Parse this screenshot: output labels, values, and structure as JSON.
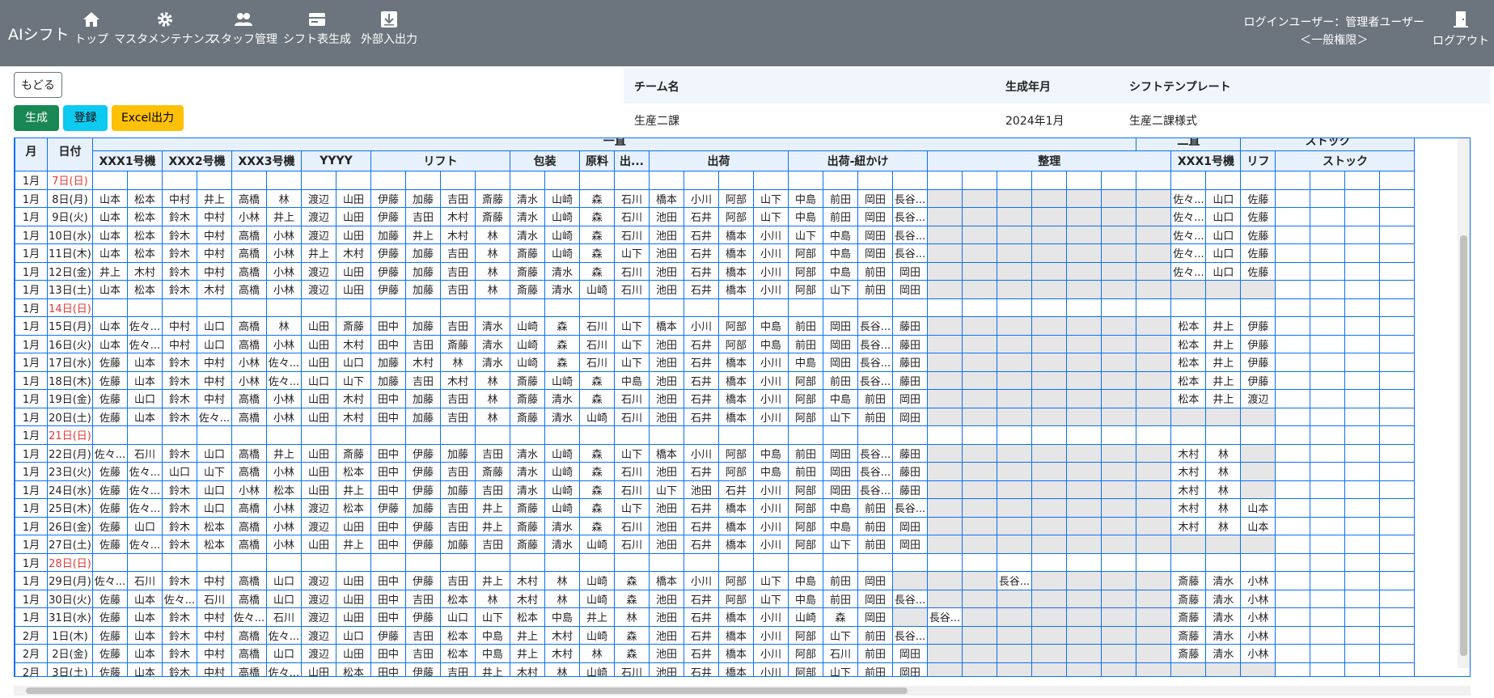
{
  "app": {
    "brand": "AIシフト"
  },
  "nav": [
    {
      "label": "トップ",
      "icon": "home-icon"
    },
    {
      "label": "マスタメンテナンス",
      "icon": "gear-icon"
    },
    {
      "label": "スタッフ管理",
      "icon": "users-icon"
    },
    {
      "label": "シフト表生成",
      "icon": "card-icon"
    },
    {
      "label": "外部入出力",
      "icon": "download-icon"
    }
  ],
  "user": {
    "line1": "ログインユーザー：管理者ユーザー",
    "line2": "＜一般権限＞",
    "logout": "ログアウト"
  },
  "buttons": {
    "back": "もどる",
    "generate": "生成",
    "register": "登録",
    "excel": "Excel出力"
  },
  "colors": {
    "nav": "#6c757d",
    "generate": "#198754",
    "register": "#0dcaf0",
    "excel": "#ffc107",
    "grid": "#0d6efd",
    "holiday": "#e53935"
  },
  "info": {
    "team_label": "チーム名",
    "month_label": "生成年月",
    "template_label": "シフトテンプレート",
    "team": "生産二課",
    "month": "2024年1月",
    "template": "生産二課様式"
  },
  "table": {
    "groups": [
      {
        "label": "一直",
        "span": 30
      },
      {
        "label": "二直",
        "span": 3
      },
      {
        "label": "ストック",
        "span": 5
      }
    ],
    "h_month": "月",
    "h_date": "日付",
    "headers": [
      {
        "label": "XXX1号機",
        "span": 2
      },
      {
        "label": "XXX2号機",
        "span": 2
      },
      {
        "label": "XXX3号機",
        "span": 2
      },
      {
        "label": "YYYY",
        "span": 2
      },
      {
        "label": "リフト",
        "span": 4
      },
      {
        "label": "包装",
        "span": 2
      },
      {
        "label": "原料",
        "span": 1
      },
      {
        "label": "出...",
        "span": 1
      },
      {
        "label": "出荷",
        "span": 4
      },
      {
        "label": "出荷-紐かけ",
        "span": 4
      },
      {
        "label": "整理",
        "span": 7
      },
      {
        "label": "XXX1号機",
        "span": 2
      },
      {
        "label": "リフ",
        "span": 1
      },
      {
        "label": "ストック",
        "span": 5
      }
    ],
    "rows": [
      {
        "m": "1月",
        "d": "7日(日)",
        "h": true,
        "c": []
      },
      {
        "m": "1月",
        "d": "8日(月)",
        "c": [
          "山本",
          "松本",
          "中村",
          "井上",
          "高橋",
          "林",
          "渡辺",
          "山田",
          "伊藤",
          "加藤",
          "吉田",
          "斎藤",
          "清水",
          "山崎",
          "森",
          "石川",
          "橋本",
          "小川",
          "阿部",
          "山下",
          "中島",
          "前田",
          "岡田",
          "長谷...",
          "",
          "",
          "",
          "",
          "",
          "",
          "",
          "佐々...",
          "山口",
          "佐藤"
        ]
      },
      {
        "m": "1月",
        "d": "9日(火)",
        "c": [
          "山本",
          "松本",
          "鈴木",
          "中村",
          "小林",
          "井上",
          "渡辺",
          "山田",
          "伊藤",
          "吉田",
          "木村",
          "斎藤",
          "清水",
          "山崎",
          "森",
          "石川",
          "池田",
          "石井",
          "阿部",
          "山下",
          "中島",
          "前田",
          "岡田",
          "長谷...",
          "",
          "",
          "",
          "",
          "",
          "",
          "",
          "佐々...",
          "山口",
          "佐藤"
        ]
      },
      {
        "m": "1月",
        "d": "10日(水)",
        "c": [
          "山本",
          "松本",
          "鈴木",
          "中村",
          "高橋",
          "小林",
          "渡辺",
          "山田",
          "加藤",
          "井上",
          "木村",
          "林",
          "清水",
          "山崎",
          "森",
          "石川",
          "池田",
          "石井",
          "橋本",
          "小川",
          "山下",
          "中島",
          "岡田",
          "長谷...",
          "",
          "",
          "",
          "",
          "",
          "",
          "",
          "佐々...",
          "山口",
          "佐藤"
        ]
      },
      {
        "m": "1月",
        "d": "11日(木)",
        "c": [
          "山本",
          "松本",
          "鈴木",
          "中村",
          "高橋",
          "小林",
          "井上",
          "木村",
          "伊藤",
          "加藤",
          "吉田",
          "林",
          "斎藤",
          "山崎",
          "森",
          "山下",
          "池田",
          "石井",
          "橋本",
          "小川",
          "阿部",
          "中島",
          "岡田",
          "長谷...",
          "",
          "",
          "",
          "",
          "",
          "",
          "",
          "佐々...",
          "山口",
          "佐藤"
        ]
      },
      {
        "m": "1月",
        "d": "12日(金)",
        "c": [
          "井上",
          "木村",
          "鈴木",
          "中村",
          "高橋",
          "小林",
          "渡辺",
          "山田",
          "伊藤",
          "加藤",
          "吉田",
          "林",
          "斎藤",
          "清水",
          "森",
          "石川",
          "池田",
          "石井",
          "橋本",
          "小川",
          "阿部",
          "中島",
          "前田",
          "岡田",
          "",
          "",
          "",
          "",
          "",
          "",
          "",
          "佐々...",
          "山口",
          "佐藤"
        ]
      },
      {
        "m": "1月",
        "d": "13日(土)",
        "c": [
          "山本",
          "松本",
          "鈴木",
          "木村",
          "高橋",
          "小林",
          "渡辺",
          "山田",
          "伊藤",
          "加藤",
          "吉田",
          "林",
          "斎藤",
          "清水",
          "山崎",
          "石川",
          "池田",
          "石井",
          "橋本",
          "小川",
          "阿部",
          "山下",
          "前田",
          "岡田",
          "",
          "",
          "",
          "",
          "",
          "",
          "",
          "",
          "",
          ""
        ]
      },
      {
        "m": "1月",
        "d": "14日(日)",
        "h": true,
        "c": []
      },
      {
        "m": "1月",
        "d": "15日(月)",
        "c": [
          "山本",
          "佐々...",
          "中村",
          "山口",
          "高橋",
          "林",
          "山田",
          "斎藤",
          "田中",
          "加藤",
          "吉田",
          "清水",
          "山崎",
          "森",
          "石川",
          "山下",
          "橋本",
          "小川",
          "阿部",
          "中島",
          "前田",
          "岡田",
          "長谷...",
          "藤田",
          "",
          "",
          "",
          "",
          "",
          "",
          "",
          "松本",
          "井上",
          "伊藤"
        ]
      },
      {
        "m": "1月",
        "d": "16日(火)",
        "c": [
          "山本",
          "佐々...",
          "中村",
          "山口",
          "高橋",
          "小林",
          "山田",
          "木村",
          "田中",
          "吉田",
          "斎藤",
          "清水",
          "山崎",
          "森",
          "石川",
          "山下",
          "池田",
          "石井",
          "阿部",
          "中島",
          "前田",
          "岡田",
          "長谷...",
          "藤田",
          "",
          "",
          "",
          "",
          "",
          "",
          "",
          "松本",
          "井上",
          "伊藤"
        ]
      },
      {
        "m": "1月",
        "d": "17日(水)",
        "c": [
          "佐藤",
          "山本",
          "鈴木",
          "中村",
          "小林",
          "佐々...",
          "山田",
          "山口",
          "加藤",
          "木村",
          "林",
          "清水",
          "山崎",
          "森",
          "石川",
          "山下",
          "池田",
          "石井",
          "橋本",
          "小川",
          "中島",
          "岡田",
          "長谷...",
          "藤田",
          "",
          "",
          "",
          "",
          "",
          "",
          "",
          "松本",
          "井上",
          "伊藤"
        ]
      },
      {
        "m": "1月",
        "d": "18日(木)",
        "c": [
          "佐藤",
          "山本",
          "鈴木",
          "中村",
          "小林",
          "佐々...",
          "山口",
          "山下",
          "加藤",
          "吉田",
          "木村",
          "林",
          "斎藤",
          "山崎",
          "森",
          "中島",
          "池田",
          "石井",
          "橋本",
          "小川",
          "阿部",
          "前田",
          "長谷...",
          "藤田",
          "",
          "",
          "",
          "",
          "",
          "",
          "",
          "松本",
          "井上",
          "伊藤"
        ]
      },
      {
        "m": "1月",
        "d": "19日(金)",
        "c": [
          "佐藤",
          "山口",
          "鈴木",
          "中村",
          "高橋",
          "小林",
          "山田",
          "木村",
          "田中",
          "加藤",
          "吉田",
          "林",
          "斎藤",
          "清水",
          "森",
          "石川",
          "池田",
          "石井",
          "橋本",
          "小川",
          "阿部",
          "中島",
          "前田",
          "岡田",
          "",
          "",
          "",
          "",
          "",
          "",
          "",
          "松本",
          "井上",
          "渡辺"
        ]
      },
      {
        "m": "1月",
        "d": "20日(土)",
        "c": [
          "佐藤",
          "山本",
          "鈴木",
          "佐々...",
          "高橋",
          "小林",
          "山田",
          "木村",
          "田中",
          "加藤",
          "吉田",
          "林",
          "斎藤",
          "清水",
          "山崎",
          "石川",
          "池田",
          "石井",
          "橋本",
          "小川",
          "阿部",
          "山下",
          "前田",
          "岡田",
          "",
          "",
          "",
          "",
          "",
          "",
          "",
          "",
          "",
          ""
        ]
      },
      {
        "m": "1月",
        "d": "21日(日)",
        "h": true,
        "c": []
      },
      {
        "m": "1月",
        "d": "22日(月)",
        "c": [
          "佐々...",
          "石川",
          "鈴木",
          "山口",
          "高橋",
          "井上",
          "山田",
          "斎藤",
          "田中",
          "伊藤",
          "加藤",
          "吉田",
          "清水",
          "山崎",
          "森",
          "山下",
          "橋本",
          "小川",
          "阿部",
          "中島",
          "前田",
          "岡田",
          "長谷...",
          "藤田",
          "",
          "",
          "",
          "",
          "",
          "",
          "",
          "木村",
          "林",
          ""
        ]
      },
      {
        "m": "1月",
        "d": "23日(火)",
        "c": [
          "佐藤",
          "佐々...",
          "山口",
          "山下",
          "高橋",
          "小林",
          "山田",
          "松本",
          "田中",
          "伊藤",
          "吉田",
          "斎藤",
          "清水",
          "山崎",
          "森",
          "石川",
          "池田",
          "石井",
          "阿部",
          "中島",
          "前田",
          "岡田",
          "長谷...",
          "藤田",
          "",
          "",
          "",
          "",
          "",
          "",
          "",
          "木村",
          "林",
          ""
        ]
      },
      {
        "m": "1月",
        "d": "24日(水)",
        "c": [
          "佐藤",
          "佐々...",
          "鈴木",
          "山口",
          "小林",
          "松本",
          "山田",
          "井上",
          "田中",
          "伊藤",
          "加藤",
          "吉田",
          "清水",
          "山崎",
          "森",
          "石川",
          "山下",
          "池田",
          "石井",
          "小川",
          "阿部",
          "岡田",
          "長谷...",
          "藤田",
          "",
          "",
          "",
          "",
          "",
          "",
          "",
          "木村",
          "林",
          ""
        ]
      },
      {
        "m": "1月",
        "d": "25日(木)",
        "c": [
          "佐藤",
          "佐々...",
          "鈴木",
          "山口",
          "高橋",
          "小林",
          "渡辺",
          "松本",
          "伊藤",
          "加藤",
          "吉田",
          "井上",
          "斎藤",
          "山崎",
          "森",
          "山下",
          "池田",
          "石井",
          "橋本",
          "小川",
          "阿部",
          "中島",
          "前田",
          "長谷...",
          "",
          "",
          "",
          "",
          "",
          "",
          "",
          "木村",
          "林",
          "山本"
        ]
      },
      {
        "m": "1月",
        "d": "26日(金)",
        "c": [
          "佐藤",
          "山口",
          "鈴木",
          "松本",
          "高橋",
          "小林",
          "渡辺",
          "山田",
          "田中",
          "伊藤",
          "吉田",
          "井上",
          "斎藤",
          "清水",
          "森",
          "石川",
          "池田",
          "石井",
          "橋本",
          "小川",
          "阿部",
          "中島",
          "前田",
          "岡田",
          "",
          "",
          "",
          "",
          "",
          "",
          "",
          "木村",
          "林",
          "山本"
        ]
      },
      {
        "m": "1月",
        "d": "27日(土)",
        "c": [
          "佐藤",
          "佐々...",
          "鈴木",
          "松本",
          "高橋",
          "小林",
          "山田",
          "井上",
          "田中",
          "伊藤",
          "加藤",
          "吉田",
          "斎藤",
          "清水",
          "山崎",
          "石川",
          "池田",
          "石井",
          "橋本",
          "小川",
          "阿部",
          "山下",
          "前田",
          "岡田",
          "",
          "",
          "",
          "",
          "",
          "",
          "",
          "",
          "",
          ""
        ]
      },
      {
        "m": "1月",
        "d": "28日(日)",
        "h": true,
        "c": []
      },
      {
        "m": "1月",
        "d": "29日(月)",
        "c": [
          "佐々...",
          "石川",
          "鈴木",
          "中村",
          "高橋",
          "山口",
          "渡辺",
          "山田",
          "田中",
          "伊藤",
          "吉田",
          "井上",
          "木村",
          "林",
          "山崎",
          "森",
          "橋本",
          "小川",
          "阿部",
          "山下",
          "中島",
          "前田",
          "岡田",
          "",
          "",
          "",
          "長谷...",
          "",
          "",
          "",
          "",
          "斎藤",
          "清水",
          "小林"
        ]
      },
      {
        "m": "1月",
        "d": "30日(火)",
        "c": [
          "佐藤",
          "山本",
          "佐々...",
          "石川",
          "高橋",
          "山口",
          "渡辺",
          "山田",
          "田中",
          "吉田",
          "松本",
          "林",
          "木村",
          "林",
          "山崎",
          "森",
          "池田",
          "石井",
          "阿部",
          "山下",
          "中島",
          "前田",
          "岡田",
          "長谷...",
          "",
          "",
          "",
          "",
          "",
          "",
          "",
          "斎藤",
          "清水",
          "小林"
        ]
      },
      {
        "m": "1月",
        "d": "31日(水)",
        "c": [
          "佐藤",
          "山本",
          "鈴木",
          "中村",
          "佐々...",
          "石川",
          "渡辺",
          "山田",
          "田中",
          "伊藤",
          "山口",
          "山下",
          "松本",
          "中島",
          "井上",
          "林",
          "池田",
          "石井",
          "橋本",
          "小川",
          "山崎",
          "森",
          "岡田",
          "",
          "長谷...",
          "",
          "",
          "",
          "",
          "",
          "",
          "斎藤",
          "清水",
          "小林"
        ]
      },
      {
        "m": "2月",
        "d": "1日(木)",
        "c": [
          "佐藤",
          "山本",
          "鈴木",
          "中村",
          "高橋",
          "佐々...",
          "渡辺",
          "山口",
          "伊藤",
          "吉田",
          "松本",
          "中島",
          "井上",
          "木村",
          "山崎",
          "森",
          "池田",
          "石井",
          "橋本",
          "小川",
          "阿部",
          "山下",
          "前田",
          "長谷...",
          "",
          "",
          "",
          "",
          "",
          "",
          "",
          "斎藤",
          "清水",
          "小林"
        ]
      },
      {
        "m": "2月",
        "d": "2日(金)",
        "c": [
          "佐藤",
          "山本",
          "鈴木",
          "中村",
          "高橋",
          "山口",
          "渡辺",
          "山田",
          "田中",
          "吉田",
          "松本",
          "中島",
          "井上",
          "木村",
          "林",
          "森",
          "池田",
          "石井",
          "橋本",
          "小川",
          "阿部",
          "石川",
          "前田",
          "岡田",
          "",
          "",
          "",
          "",
          "",
          "",
          "",
          "斎藤",
          "清水",
          "小林"
        ]
      },
      {
        "m": "2月",
        "d": "3日(土)",
        "c": [
          "佐藤",
          "山本",
          "鈴木",
          "中村",
          "高橋",
          "佐々...",
          "山田",
          "松本",
          "田中",
          "伊藤",
          "吉田",
          "井上",
          "木村",
          "林",
          "山崎",
          "石川",
          "池田",
          "石井",
          "橋本",
          "小川",
          "阿部",
          "山下",
          "前田",
          "岡田",
          "",
          "",
          "",
          "",
          "",
          "",
          "",
          "",
          "",
          ""
        ]
      }
    ]
  }
}
